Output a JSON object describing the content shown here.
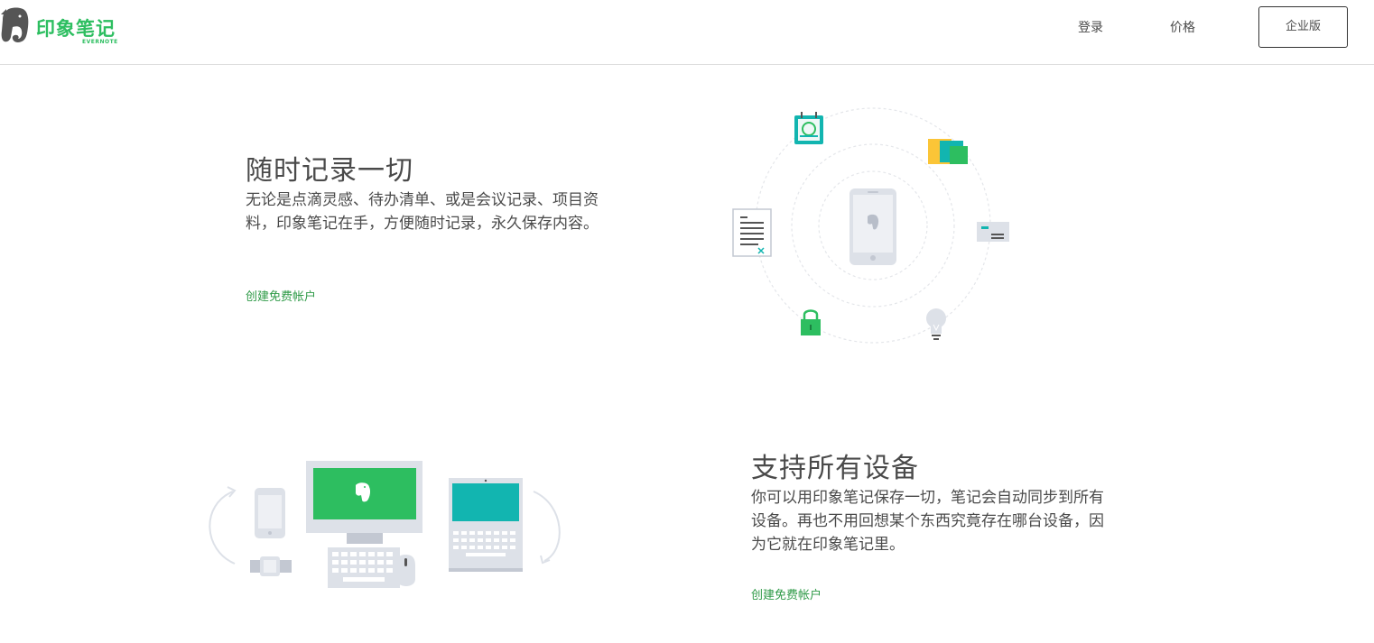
{
  "header": {
    "logo_text": "印象笔记",
    "logo_sub": "EVERNOTE",
    "nav": {
      "login": "登录",
      "pricing": "价格",
      "business": "企业版"
    }
  },
  "sections": [
    {
      "title": "随时记录一切",
      "description": "无论是点滴灵感、待办清单、或是会议记录、项目资料，印象笔记在手，方便随时记录，永久保存内容。",
      "cta": "创建免费帐户"
    },
    {
      "title": "支持所有设备",
      "description": "你可以用印象笔记保存一切，笔记会自动同步到所有设备。再也不用回想某个东西究竟存在哪台设备，因为它就在印象笔记里。",
      "cta": "创建免费帐户"
    }
  ],
  "colors": {
    "brand": "#2dbe60",
    "link": "#2e9a47",
    "teal": "#12b5b0",
    "yellow": "#fbc537",
    "device_gray": "#dde1e8"
  }
}
